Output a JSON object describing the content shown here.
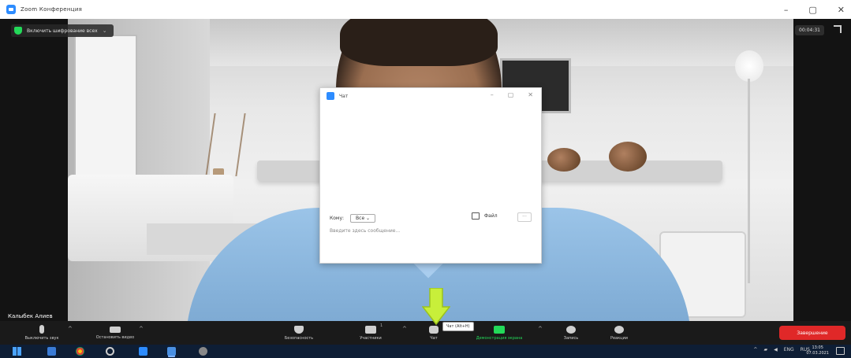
{
  "window": {
    "title": "Zoom Конференция",
    "controls": [
      "–",
      "▢",
      "✕"
    ]
  },
  "meeting": {
    "encryption_label": "Включить шифрование всех",
    "timer": "00:04:31",
    "participant_name": "Калыбек Алиев"
  },
  "chat": {
    "title": "Чат",
    "controls": [
      "–",
      "▢",
      "✕"
    ],
    "to_label": "Кому:",
    "to_value": "Все",
    "file_label": "Файл",
    "more_label": "···",
    "input_placeholder": "Введите здесь сообщение..."
  },
  "toolbar": {
    "mute_label": "Выключить звук",
    "video_label": "Остановить видео",
    "security_label": "Безопасность",
    "participants_label": "Участники",
    "participants_count": "1",
    "chat_label": "Чат",
    "chat_tooltip": "Чат (Alt+H)",
    "share_label": "Демонстрация экрана",
    "record_label": "Запись",
    "reactions_label": "Реакции",
    "end_label": "Завершение"
  },
  "taskbar": {
    "tray": [
      "^",
      "ENG",
      "RUS"
    ],
    "clock_time": "13:05",
    "clock_date": "07.03.2021"
  },
  "colors": {
    "accent": "#2d8cff",
    "share_green": "#23d959",
    "end_red": "#e02828",
    "arrow": "#c8ef3a"
  }
}
